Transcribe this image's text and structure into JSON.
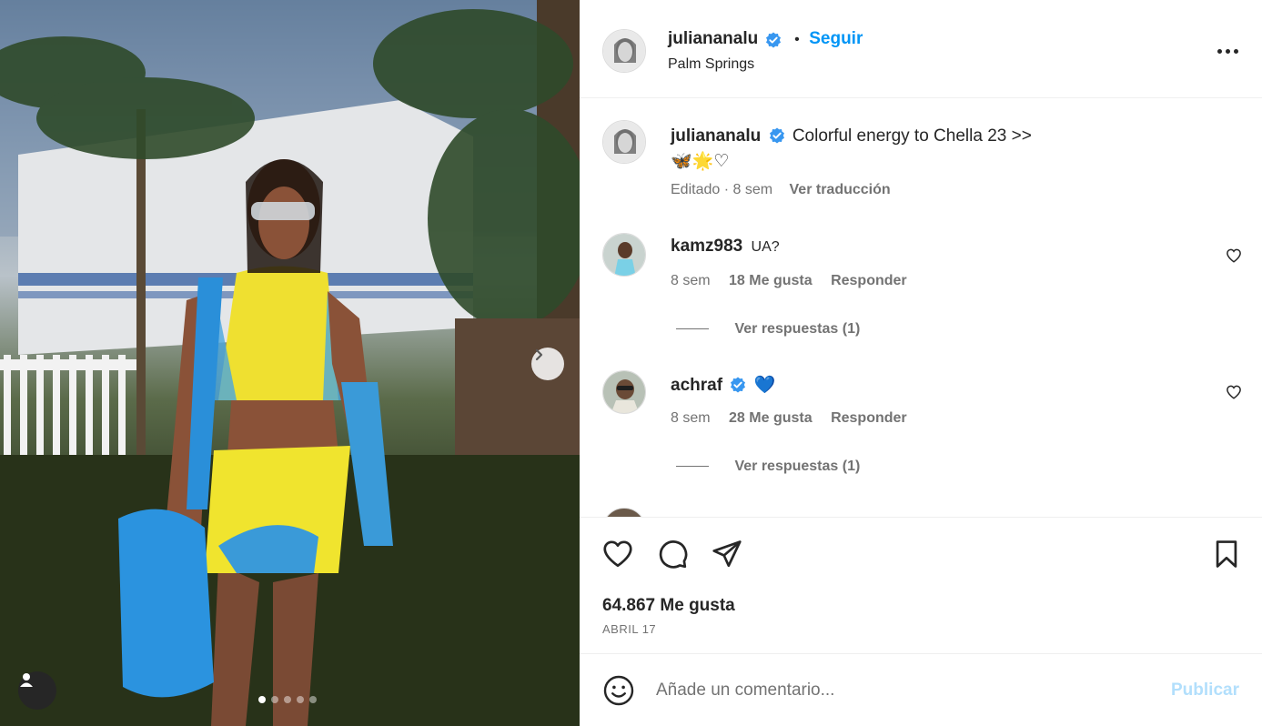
{
  "post": {
    "author": "juliananalu",
    "location": "Palm Springs",
    "follow_label": "Seguir",
    "separator": "•",
    "caption_text": "Colorful energy to Chella 23 >>",
    "caption_emojis": "🦋🌟♡",
    "caption_meta": "Editado · 8 sem",
    "translate_label": "Ver traducción",
    "likes": "64.867 Me gusta",
    "date": "ABRIL 17",
    "carousel_total": 5,
    "carousel_index": 1
  },
  "comments": [
    {
      "user": "kamz983",
      "text": "UA?",
      "age": "8 sem",
      "likes": "18 Me gusta",
      "reply_label": "Responder",
      "view_replies": "Ver respuestas (1)"
    },
    {
      "user": "achraf",
      "text": "💙",
      "age": "8 sem",
      "likes": "28 Me gusta",
      "reply_label": "Responder",
      "view_replies": "Ver respuestas (1)"
    }
  ],
  "composer": {
    "placeholder": "Añade un comentario...",
    "publish_label": "Publicar"
  },
  "colors": {
    "link_blue": "#0095f6",
    "verified_blue": "#3897f0",
    "muted": "#737373",
    "publish_disabled": "#b2dffc"
  },
  "icons": [
    "verified-badge-icon",
    "more-options-icon",
    "heart-icon",
    "comment-icon",
    "share-icon",
    "bookmark-icon",
    "emoji-icon",
    "chevron-right-icon",
    "user-tag-icon"
  ]
}
